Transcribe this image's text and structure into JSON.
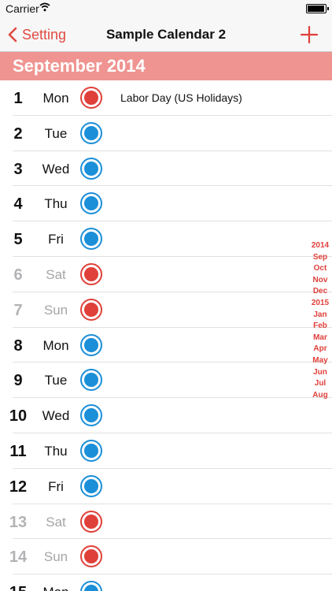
{
  "status_bar": {
    "carrier": "Carrier",
    "time": ""
  },
  "nav": {
    "back_label": "Setting",
    "title": "Sample Calendar 2",
    "add_label": "+"
  },
  "month_header": "September 2014",
  "colors": {
    "accent": "#e0403a",
    "header_bg": "#ef9490",
    "blue": "#1b8fd8",
    "weekend_text": "#a5a5a8"
  },
  "days": [
    {
      "num": "1",
      "weekday": "Mon",
      "dot": "red",
      "event": "Labor Day (US Holidays)",
      "weekend": false
    },
    {
      "num": "2",
      "weekday": "Tue",
      "dot": "blue",
      "event": "",
      "weekend": false
    },
    {
      "num": "3",
      "weekday": "Wed",
      "dot": "blue",
      "event": "",
      "weekend": false
    },
    {
      "num": "4",
      "weekday": "Thu",
      "dot": "blue",
      "event": "",
      "weekend": false
    },
    {
      "num": "5",
      "weekday": "Fri",
      "dot": "blue",
      "event": "",
      "weekend": false
    },
    {
      "num": "6",
      "weekday": "Sat",
      "dot": "red",
      "event": "",
      "weekend": true
    },
    {
      "num": "7",
      "weekday": "Sun",
      "dot": "red",
      "event": "",
      "weekend": true
    },
    {
      "num": "8",
      "weekday": "Mon",
      "dot": "blue",
      "event": "",
      "weekend": false
    },
    {
      "num": "9",
      "weekday": "Tue",
      "dot": "blue",
      "event": "",
      "weekend": false
    },
    {
      "num": "10",
      "weekday": "Wed",
      "dot": "blue",
      "event": "",
      "weekend": false
    },
    {
      "num": "11",
      "weekday": "Thu",
      "dot": "blue",
      "event": "",
      "weekend": false
    },
    {
      "num": "12",
      "weekday": "Fri",
      "dot": "blue",
      "event": "",
      "weekend": false
    },
    {
      "num": "13",
      "weekday": "Sat",
      "dot": "red",
      "event": "",
      "weekend": true
    },
    {
      "num": "14",
      "weekday": "Sun",
      "dot": "red",
      "event": "",
      "weekend": true
    },
    {
      "num": "15",
      "weekday": "Mon",
      "dot": "blue",
      "event": "",
      "weekend": false
    }
  ],
  "index_bar": [
    "2014",
    "Sep",
    "Oct",
    "Nov",
    "Dec",
    "2015",
    "Jan",
    "Feb",
    "Mar",
    "Apr",
    "May",
    "Jun",
    "Jul",
    "Aug"
  ]
}
